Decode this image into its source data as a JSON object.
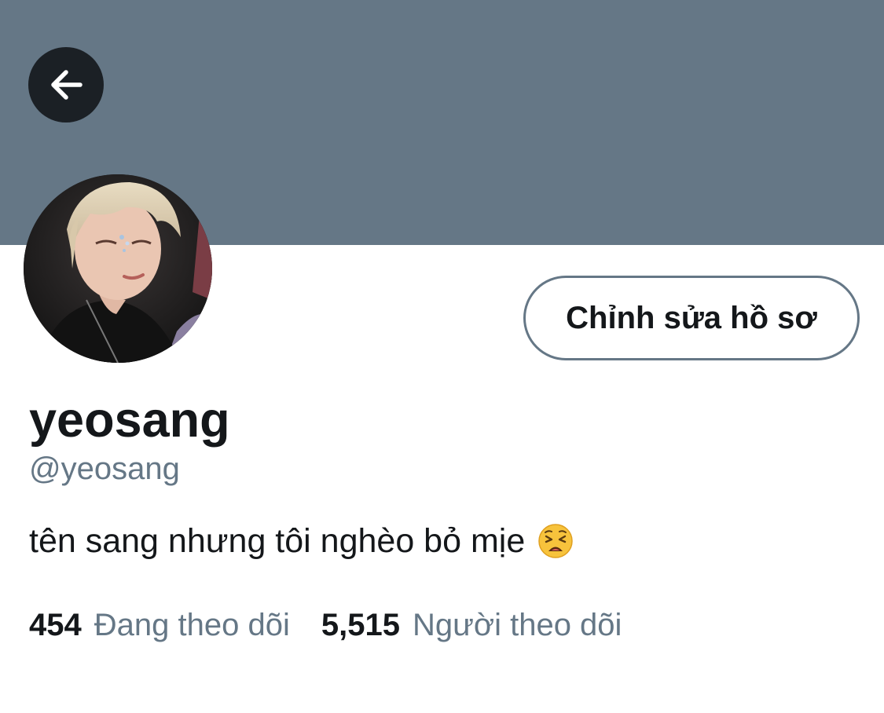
{
  "header": {
    "back_icon": "arrow-left-icon",
    "banner_color": "#657786"
  },
  "profile": {
    "edit_label": "Chỉnh sửa hồ sơ",
    "display_name": "yeosang",
    "handle": "@yeosang",
    "bio": "tên sang nhưng tôi nghèo bỏ mịe",
    "bio_emoji": "weary-face-icon"
  },
  "stats": {
    "following_count": "454",
    "following_label": "Đang theo dõi",
    "followers_count": "5,515",
    "followers_label": "Người theo dõi"
  },
  "colors": {
    "text": "#14171a",
    "secondary_text": "#657786",
    "button_border": "#657786"
  }
}
